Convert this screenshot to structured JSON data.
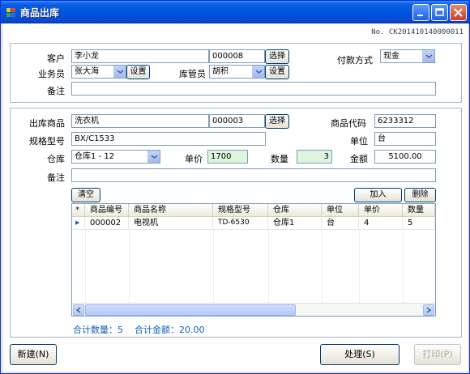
{
  "window": {
    "title": "商品出库"
  },
  "doc": {
    "no_label": "No.",
    "no_value": "CK201410140000011"
  },
  "top": {
    "customer_label": "客户",
    "customer_name": "李小龙",
    "customer_code": "000008",
    "select_btn": "选择",
    "payment_label": "付款方式",
    "payment_value": "现金",
    "salesman_label": "业务员",
    "salesman_value": "张大海",
    "set_btn": "设置",
    "keeper_label": "库管员",
    "keeper_value": "胡积",
    "remark_label": "备注",
    "remark_value": ""
  },
  "detail": {
    "product_label": "出库商品",
    "product_name": "洗衣机",
    "product_no": "000003",
    "select_btn": "选择",
    "code_label": "商品代码",
    "code_value": "6233312",
    "model_label": "规格型号",
    "model_value": "BX/C1533",
    "unit_label": "单位",
    "unit_value": "台",
    "warehouse_label": "仓库",
    "warehouse_value": "仓库1 - 12",
    "price_label": "单价",
    "price_value": "1700",
    "qty_label": "数量",
    "qty_value": "3",
    "amount_label": "金额",
    "amount_value": "5100.00",
    "remark_label": "备注",
    "remark_value": "",
    "clear_btn": "清空",
    "add_btn": "加入",
    "delete_btn": "删除"
  },
  "grid": {
    "columns": [
      "*",
      "商品编号",
      "商品名称",
      "规格型号",
      "仓库",
      "单位",
      "单价",
      "数量"
    ],
    "rows": [
      {
        "marker": "▶",
        "no": "000002",
        "name": "电视机",
        "model": "TD-6530",
        "warehouse": "仓库1",
        "unit": "台",
        "price": "4",
        "qty": "5"
      }
    ]
  },
  "summary": {
    "total_qty": "合计数量：5",
    "total_amount": "合计金额：20.00"
  },
  "footer": {
    "new_btn": "新建(N)",
    "process_btn": "处理(S)",
    "print_btn": "打印(P)"
  }
}
